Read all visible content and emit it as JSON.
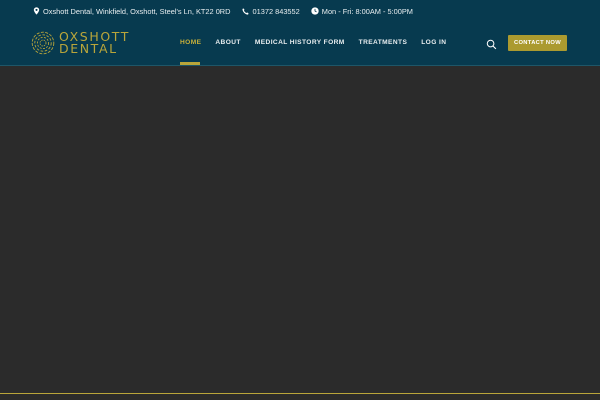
{
  "topbar": {
    "address": "Oxshott Dental, Winkfield, Oxshott, Steel's Ln, KT22 0RD",
    "phone": "01372 843552",
    "hours": "Mon - Fri: 8:00AM - 5:00PM",
    "icons": [
      "location-pin-icon",
      "phone-icon",
      "clock-icon"
    ]
  },
  "logo": {
    "line1": "OXSHOTT",
    "line2": "DENTAL"
  },
  "nav": {
    "items": [
      "HOME",
      "ABOUT",
      "MEDICAL HISTORY FORM",
      "TREATMENTS",
      "LOG IN"
    ],
    "active": "HOME"
  },
  "header_actions": {
    "contact_label": "CONTACT NOW",
    "search_icon": "search-icon"
  },
  "colors": {
    "header_bg": "#073a4f",
    "accent_gold": "#b9a53a",
    "page_bg": "#2b2b2b"
  }
}
